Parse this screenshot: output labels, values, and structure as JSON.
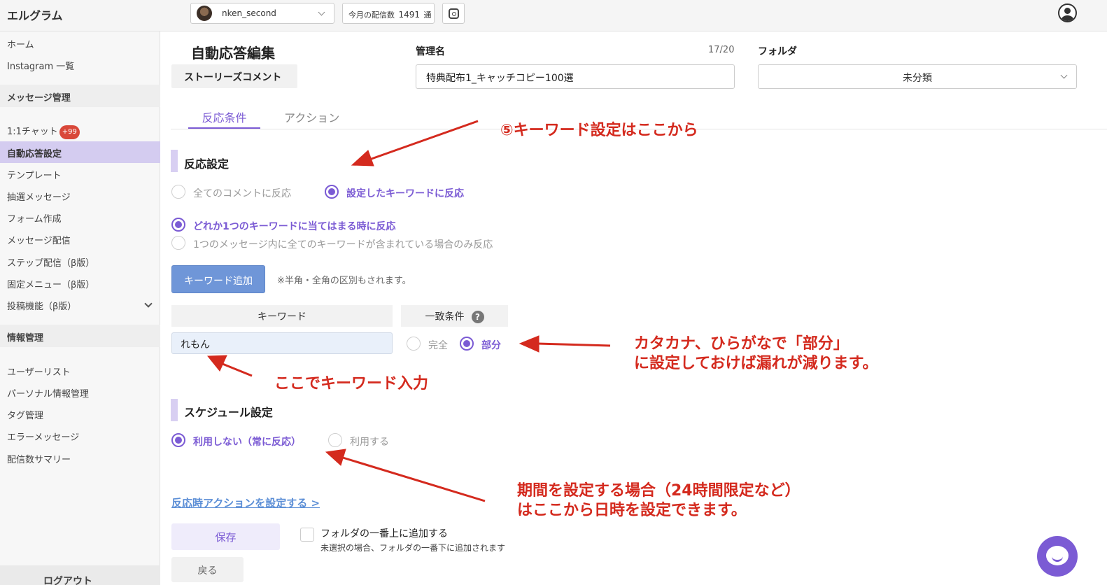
{
  "app": {
    "brand": "エルグラム",
    "account_name": "nken_second",
    "monthly_count": {
      "prefix": "今月の配信数",
      "value": "1491",
      "suffix": "通"
    }
  },
  "sidebar": {
    "items": [
      {
        "label": "ホーム"
      },
      {
        "label": "Instagram 一覧"
      }
    ],
    "section_messages": "メッセージ管理",
    "message_items": [
      {
        "label": "1:1チャット",
        "badge": "+99"
      },
      {
        "label": "自動応答設定"
      },
      {
        "label": "テンプレート"
      },
      {
        "label": "抽選メッセージ"
      },
      {
        "label": "フォーム作成"
      },
      {
        "label": "メッセージ配信"
      },
      {
        "label": "ステップ配信（β版）"
      },
      {
        "label": "固定メニュー（β版）"
      },
      {
        "label": "投稿機能（β版）"
      }
    ],
    "section_info": "情報管理",
    "info_items": [
      {
        "label": "ユーザーリスト"
      },
      {
        "label": "パーソナル情報管理"
      },
      {
        "label": "タグ管理"
      },
      {
        "label": "エラーメッセージ"
      },
      {
        "label": "配信数サマリー"
      }
    ],
    "logout": "ログアウト"
  },
  "editor": {
    "title": "自動応答編集",
    "type": "ストーリーズコメント",
    "name_label": "管理名",
    "name_count": "17/20",
    "name_value": "特典配布1_キャッチコピー100選",
    "folder_label": "フォルダ",
    "folder_value": "未分類",
    "tabs": [
      "反応条件",
      "アクション"
    ],
    "reaction": {
      "title": "反応設定",
      "scope_options": [
        "全てのコメントに反応",
        "設定したキーワードに反応"
      ],
      "match_options": [
        "どれか1つのキーワードに当てはまる時に反応",
        "1つのメッセージ内に全てのキーワードが含まれている場合のみ反応"
      ],
      "add_keyword": "キーワード追加",
      "note": "※半角・全角の区別もされます。",
      "col_keyword": "キーワード",
      "col_match": "一致条件",
      "help": "?",
      "keyword_value": "れもん",
      "match_exact": "完全",
      "match_partial": "部分"
    },
    "schedule": {
      "title": "スケジュール設定",
      "options": [
        "利用しない（常に反応）",
        "利用する"
      ]
    },
    "action_link": "反応時アクションを設定する >",
    "save": "保存",
    "checkbox_label": "フォルダの一番上に追加する",
    "checkbox_hint": "未選択の場合、フォルダの一番下に追加されます",
    "back": "戻る"
  },
  "annotations": {
    "a1": "⑤キーワード設定はここから",
    "a2_line1": "カタカナ、ひらがなで「部分」",
    "a2_line2": "に設定しておけば漏れが減ります。",
    "a3": "ここでキーワード入力",
    "a4_line1": "期間を設定する場合（24時間限定など）",
    "a4_line2": "はここから日時を設定できます。"
  },
  "colors": {
    "accent": "#7b5bd4",
    "annotation": "#d42a1e",
    "link": "#5b8ed6",
    "button": "#6f96d8"
  }
}
